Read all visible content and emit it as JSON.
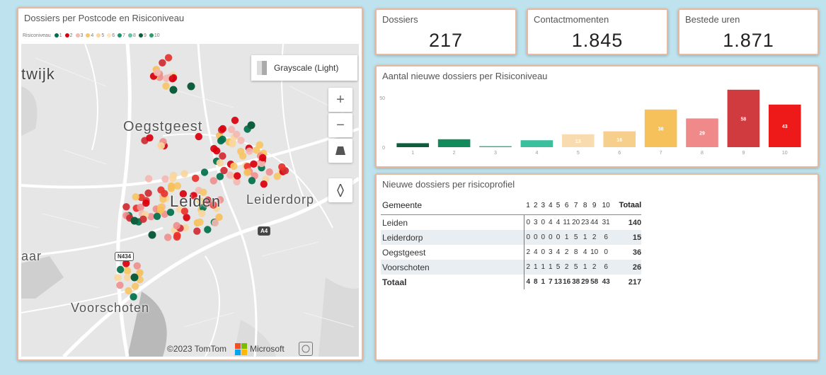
{
  "map": {
    "title": "Dossiers per Postcode en Risiconiveau",
    "legend_label": "Risiconiveau",
    "legend": [
      {
        "label": "1",
        "color": "#00704a"
      },
      {
        "label": "2",
        "color": "#d9000d"
      },
      {
        "label": "3",
        "color": "#f4b9b2"
      },
      {
        "label": "4",
        "color": "#f6c667"
      },
      {
        "label": "5",
        "color": "#f9d79e"
      },
      {
        "label": "6",
        "color": "#fbe7c0"
      },
      {
        "label": "7",
        "color": "#1a936f"
      },
      {
        "label": "8",
        "color": "#66c2a5"
      },
      {
        "label": "9",
        "color": "#0d5c3a"
      },
      {
        "label": "10",
        "color": "#2b9d67"
      }
    ],
    "style_switch": "Grayscale (Light)",
    "places": [
      "twijk",
      "Oegstgeest",
      "Leiden",
      "Leiderdorp",
      "Voorschoten",
      "aar"
    ],
    "road_badges": [
      "A4",
      "N434"
    ],
    "copyright": "©2023 TomTom",
    "vendor": "Microsoft",
    "zoom_in": "+",
    "zoom_out": "−"
  },
  "kpis": [
    {
      "label": "Dossiers",
      "value": "217"
    },
    {
      "label": "Contactmomenten",
      "value": "1.845"
    },
    {
      "label": "Bestede uren",
      "value": "1.871"
    }
  ],
  "chart_data": {
    "type": "bar",
    "title": "Aantal nieuwe dossiers per Risiconiveau",
    "categories": [
      "1",
      "2",
      "3",
      "4",
      "5",
      "6",
      "7",
      "8",
      "9",
      "10"
    ],
    "values": [
      4,
      8,
      1,
      7,
      13,
      16,
      38,
      29,
      58,
      43
    ],
    "data_labels": [
      "",
      "",
      "",
      "",
      "13",
      "16",
      "38",
      "29",
      "58",
      "43"
    ],
    "colors": [
      "#0e5d3c",
      "#138a5b",
      "#2fae8a",
      "#3bbf9c",
      "#f9dbb0",
      "#f6cf8c",
      "#f6c05a",
      "#f0898a",
      "#cf3b3e",
      "#ee1a1a"
    ],
    "yticks": [
      "0",
      "50"
    ],
    "ylim": [
      0,
      60
    ],
    "xlabel": "",
    "ylabel": ""
  },
  "table": {
    "title": "Nieuwe dossiers per risicoprofiel",
    "header": [
      "Gemeente",
      "1",
      "2",
      "3",
      "4",
      "5",
      "6",
      "7",
      "8",
      "9",
      "10",
      "Totaal"
    ],
    "rows": [
      {
        "name": "Leiden",
        "values": [
          "0",
          "3",
          "0",
          "4",
          "4",
          "11",
          "20",
          "23",
          "44",
          "31"
        ],
        "total": "140"
      },
      {
        "name": "Leiderdorp",
        "values": [
          "0",
          "0",
          "0",
          "0",
          "0",
          "1",
          "5",
          "1",
          "2",
          "6"
        ],
        "total": "15"
      },
      {
        "name": "Oegstgeest",
        "values": [
          "2",
          "4",
          "0",
          "3",
          "4",
          "2",
          "8",
          "4",
          "10",
          "0"
        ],
        "total": "36"
      },
      {
        "name": "Voorschoten",
        "values": [
          "2",
          "1",
          "1",
          "1",
          "5",
          "2",
          "5",
          "1",
          "2",
          "6"
        ],
        "total": "26"
      }
    ],
    "total_row": {
      "name": "Totaal",
      "values": [
        "4",
        "8",
        "1",
        "7",
        "13",
        "16",
        "38",
        "29",
        "58",
        "43"
      ],
      "total": "217"
    }
  }
}
